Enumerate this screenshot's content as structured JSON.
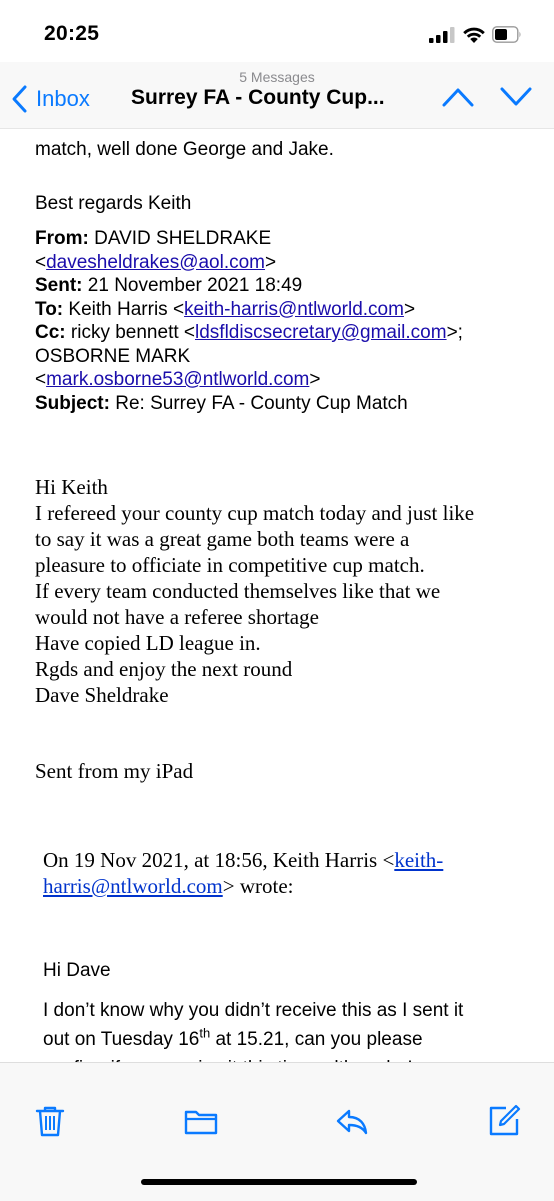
{
  "status": {
    "time": "20:25"
  },
  "nav": {
    "message_count": "5 Messages",
    "back_label": "Inbox",
    "title": "Surrey FA  - County Cup..."
  },
  "email": {
    "top_fragment": "match, well done George and Jake.",
    "signoff": "Best regards Keith",
    "header": {
      "from_label": "From:",
      "from_name": "DAVID SHELDRAKE",
      "from_email": "davesheldrakes@aol.com",
      "sent_label": "Sent:",
      "sent_value": "21 November 2021 18:49",
      "to_label": "To:",
      "to_name": "Keith Harris <",
      "to_email": "keith-harris@ntlworld.com",
      "cc_label": "Cc:",
      "cc_name": "ricky bennett <",
      "cc_email": "ldsfldiscsecretary@gmail.com",
      "cc_name2": "OSBORNE MARK",
      "cc_email2": "mark.osborne53@ntlworld.com",
      "subject_label": "Subject:",
      "subject_value": "Re: Surrey FA - County Cup Match"
    },
    "body_lines": [
      "Hi Keith",
      "I refereed your county cup match today and just like",
      "to say it was a great game both teams were a",
      "pleasure to officiate in competitive cup match.",
      "If every team conducted themselves like that we",
      "would not have a referee shortage",
      "Have copied LD league in.",
      "Rgds and enjoy the next round",
      "Dave Sheldrake"
    ],
    "sent_from": "Sent from my iPad",
    "quote": {
      "intro": "On 19 Nov 2021, at 18:56, Keith Harris <",
      "email_part1": "keith-",
      "email_part2": "harris@ntlworld.com",
      "wrote": "> wrote:"
    },
    "reply": {
      "greeting": "Hi Dave",
      "line1": "I don’t know why you didn’t receive this as I sent it",
      "line2_pre": "out on Tuesday 16",
      "line2_sup": "th",
      "line2_post": " at 15.21, can you please",
      "line3": "confirm if you receive it this time, although, I now"
    }
  },
  "toolbar": {
    "icons": [
      "trash-icon",
      "folder-icon",
      "reply-icon",
      "compose-icon"
    ]
  },
  "colors": {
    "accent": "#0a7aff",
    "link": "#1a0dab"
  }
}
